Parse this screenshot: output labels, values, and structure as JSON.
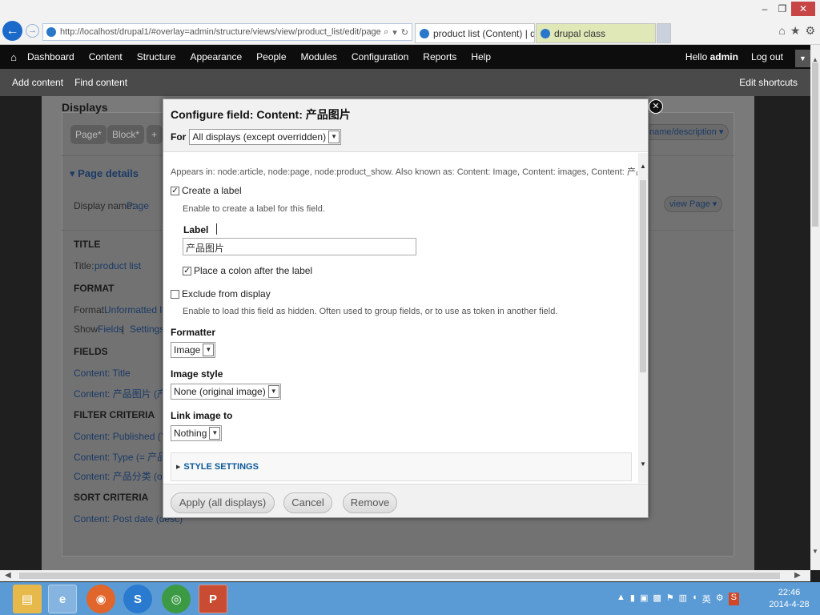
{
  "browser": {
    "url": "http://localhost/drupal1/#overlay=admin/structure/views/view/product_list/edit/page",
    "tabs": [
      {
        "label": "product list (Content) | dr..."
      },
      {
        "label": "drupal class"
      }
    ]
  },
  "toolbar": {
    "items": [
      "Dashboard",
      "Content",
      "Structure",
      "Appearance",
      "People",
      "Modules",
      "Configuration",
      "Reports",
      "Help"
    ],
    "hello_prefix": "Hello",
    "user": "admin",
    "logout": "Log out"
  },
  "shortcuts": {
    "items": [
      "Add content",
      "Find content"
    ],
    "edit": "Edit shortcuts"
  },
  "background": {
    "heading": "Displays",
    "tabs": [
      "Page*",
      "Block*",
      "+"
    ],
    "name_description": "name/description ▾",
    "page_details": "▾ Page details",
    "display_name_label": "Display name:",
    "display_name_value": "Page",
    "view_page": "view Page ▾",
    "title_head": "TITLE",
    "title_label": "Title:",
    "title_value": "product list",
    "format_head": "FORMAT",
    "format_label": "Format:",
    "format_value": "Unformatted list",
    "show_label": "Show:",
    "show_fields": "Fields",
    "show_sep": "|",
    "show_settings": "Settings",
    "fields_head": "FIELDS",
    "field1": "Content: Title",
    "field2": "Content: 产品图片 (产品图",
    "filter_head": "FILTER CRITERIA",
    "filter1": "Content: Published (Yes)",
    "filter2": "Content: Type (= 产品展示",
    "filter3": "Content: 产品分类 (or Unl",
    "sort_head": "SORT CRITERIA",
    "sort1": "Content: Post date (desc)"
  },
  "modal": {
    "title": "Configure field: Content: 产品图片",
    "for_label": "For",
    "for_value": "All displays (except overridden)",
    "appears_in": "Appears in: node:article, node:page, node:product_show. Also known as: Content: Image, Content: images, Content: 产品图片.",
    "create_label": "Create a label",
    "create_label_desc": "Enable to create a label for this field.",
    "label_title": "Label",
    "label_value": "产品图片",
    "colon_label": "Place a colon after the label",
    "exclude_label": "Exclude from display",
    "exclude_desc": "Enable to load this field as hidden. Often used to group fields, or to use as token in another field.",
    "formatter_title": "Formatter",
    "formatter_value": "Image",
    "image_style_title": "Image style",
    "image_style_value": "None (original image)",
    "link_image_title": "Link image to",
    "link_image_value": "Nothing",
    "style_settings": "STYLE SETTINGS",
    "apply_button": "Apply (all displays)",
    "cancel_button": "Cancel",
    "remove_button": "Remove"
  },
  "taskbar": {
    "clock_time": "22:46",
    "clock_date": "2014-4-28",
    "tray_lang": "英"
  },
  "colors": {
    "toolbar_bg": "#0d0d0d",
    "shortcut_bg": "#4a4a4a",
    "link_blue": "#0b5999",
    "taskbar_bg": "#5b9bd5"
  }
}
